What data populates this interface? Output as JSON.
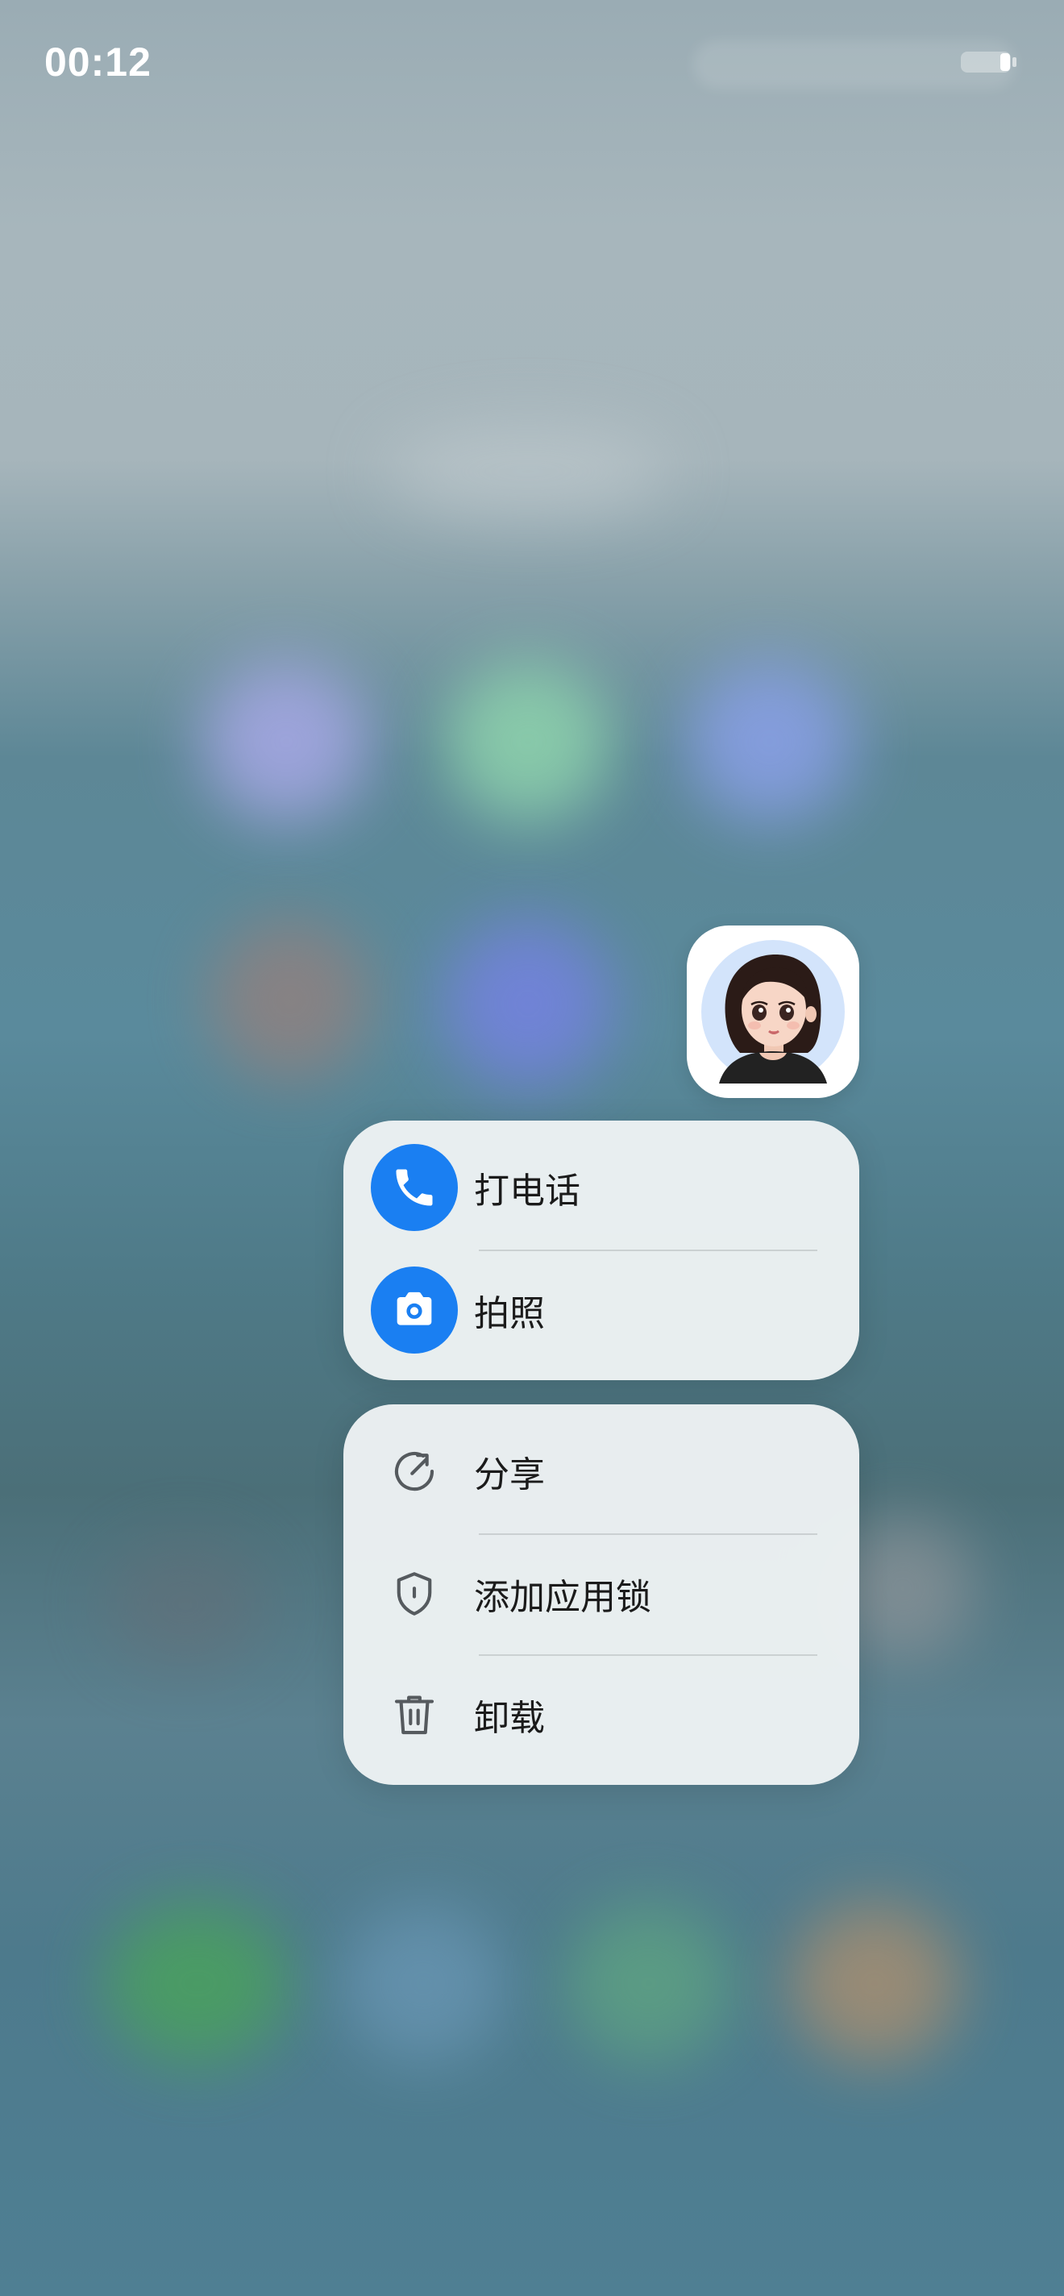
{
  "status_bar": {
    "time": "00:12"
  },
  "app": {
    "icon": "avatar-girl-icon"
  },
  "shortcut_menu": {
    "items": [
      {
        "label": "打电话",
        "icon": "phone-icon",
        "color": "#1a7ff2"
      },
      {
        "label": "拍照",
        "icon": "camera-icon",
        "color": "#1a7ff2"
      }
    ]
  },
  "system_menu": {
    "items": [
      {
        "label": "分享",
        "icon": "share-icon"
      },
      {
        "label": "添加应用锁",
        "icon": "shield-lock-icon"
      },
      {
        "label": "卸载",
        "icon": "trash-icon"
      }
    ]
  }
}
